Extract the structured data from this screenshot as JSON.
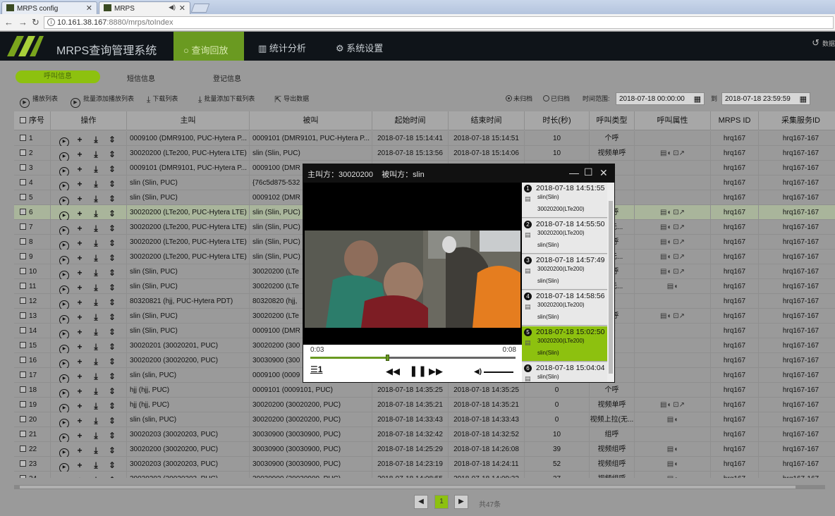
{
  "browser": {
    "tabs": [
      {
        "label": "MRPS config"
      },
      {
        "label": "MRPS"
      }
    ],
    "url_host": "10.161.38.167",
    "url_path": ":8880/mrps/toIndex"
  },
  "header": {
    "brand": "MRPS查询管理系统",
    "menu": [
      {
        "label": "查询回放"
      },
      {
        "label": "统计分析"
      },
      {
        "label": "系统设置"
      }
    ],
    "right_label": "数据"
  },
  "subtabs": [
    {
      "label": "呼叫信息"
    },
    {
      "label": "短信信息"
    },
    {
      "label": "登记信息"
    }
  ],
  "toolbar": {
    "play_list": "播放列表",
    "batch_add_play": "批量添加播放列表",
    "download_list": "下载列表",
    "batch_add_download": "批量添加下载列表",
    "export": "导出数据",
    "radio_unarchived": "未归档",
    "radio_archived": "已归档",
    "time_range": "时间范围:",
    "start_time": "2018-07-18 00:00:00",
    "to": "到",
    "end_time": "2018-07-18 23:59:59"
  },
  "table": {
    "columns": [
      "序号",
      "操作",
      "主叫",
      "被叫",
      "起始时间",
      "结束时间",
      "时长(秒)",
      "呼叫类型",
      "呼叫属性",
      "MRPS ID",
      "采集服务ID"
    ],
    "rows": [
      {
        "no": "1",
        "caller": "0009100 (DMR9100, PUC-Hytera P...",
        "callee": "0009101 (DMR9101, PUC-Hytera P...",
        "start": "2018-07-18 15:14:41",
        "end": "2018-07-18 15:14:51",
        "dur": "10",
        "type": "个呼",
        "attr": "",
        "mrps": "hrq167",
        "svc": "hrq167-167"
      },
      {
        "no": "2",
        "caller": "30020200 (LTe200, PUC-Hytera LTE)",
        "callee": "slin (Slin, PUC)",
        "start": "2018-07-18 15:13:56",
        "end": "2018-07-18 15:14:06",
        "dur": "10",
        "type": "视频单呼",
        "attr": "▤◖ ⊡↗",
        "mrps": "hrq167",
        "svc": "hrq167-167"
      },
      {
        "no": "3",
        "caller": "0009101 (DMR9101, PUC-Hytera P...",
        "callee": "0009100 (DMR",
        "start": "",
        "end": "",
        "dur": "",
        "type": "呼",
        "attr": "",
        "mrps": "hrq167",
        "svc": "hrq167-167"
      },
      {
        "no": "4",
        "caller": "slin (Slin, PUC)",
        "callee": "{76c5d875-532",
        "start": "",
        "end": "",
        "dur": "",
        "type": "级",
        "attr": "",
        "mrps": "hrq167",
        "svc": "hrq167-167"
      },
      {
        "no": "5",
        "caller": "slin (Slin, PUC)",
        "callee": "0009102 (DMR",
        "start": "",
        "end": "",
        "dur": "",
        "type": "呼",
        "attr": "",
        "mrps": "hrq167",
        "svc": "hrq167-167"
      },
      {
        "no": "6",
        "caller": "30020200 (LTe200, PUC-Hytera LTE)",
        "callee": "slin (Slin, PUC)",
        "start": "",
        "end": "",
        "dur": "",
        "type": "单呼",
        "attr": "▤◖ ⊡↗",
        "mrps": "hrq167",
        "svc": "hrq167-167"
      },
      {
        "no": "7",
        "caller": "30020200 (LTe200, PUC-Hytera LTE)",
        "callee": "slin (Slin, PUC)",
        "start": "",
        "end": "",
        "dur": "",
        "type": "呼(无...",
        "attr": "▤◖ ⊡↗",
        "mrps": "hrq167",
        "svc": "hrq167-167"
      },
      {
        "no": "8",
        "caller": "30020200 (LTe200, PUC-Hytera LTE)",
        "callee": "slin (Slin, PUC)",
        "start": "",
        "end": "",
        "dur": "",
        "type": "单呼",
        "attr": "▤◖ ⊡↗",
        "mrps": "hrq167",
        "svc": "hrq167-167"
      },
      {
        "no": "9",
        "caller": "30020200 (LTe200, PUC-Hytera LTE)",
        "callee": "slin (Slin, PUC)",
        "start": "",
        "end": "",
        "dur": "",
        "type": "呼(无...",
        "attr": "▤◖ ⊡↗",
        "mrps": "hrq167",
        "svc": "hrq167-167"
      },
      {
        "no": "10",
        "caller": "slin (Slin, PUC)",
        "callee": "30020200 (LTe",
        "start": "",
        "end": "",
        "dur": "",
        "type": "单呼",
        "attr": "▤◖ ⊡↗",
        "mrps": "hrq167",
        "svc": "hrq167-167"
      },
      {
        "no": "11",
        "caller": "slin (Slin, PUC)",
        "callee": "30020200 (LTe",
        "start": "",
        "end": "",
        "dur": "",
        "type": "拉(无...",
        "attr": "▤◖",
        "mrps": "hrq167",
        "svc": "hrq167-167"
      },
      {
        "no": "12",
        "caller": "80320821 (hjj, PUC-Hytera PDT)",
        "callee": "80320820 (hjj,",
        "start": "",
        "end": "",
        "dur": "",
        "type": "呼",
        "attr": "",
        "mrps": "hrq167",
        "svc": "hrq167-167"
      },
      {
        "no": "13",
        "caller": "slin (Slin, PUC)",
        "callee": "30020200 (LTe",
        "start": "",
        "end": "",
        "dur": "",
        "type": "单呼",
        "attr": "▤◖ ⊡↗",
        "mrps": "hrq167",
        "svc": "hrq167-167"
      },
      {
        "no": "14",
        "caller": "slin (Slin, PUC)",
        "callee": "0009100 (DMR",
        "start": "",
        "end": "",
        "dur": "",
        "type": "呼",
        "attr": "",
        "mrps": "hrq167",
        "svc": "hrq167-167"
      },
      {
        "no": "15",
        "caller": "30020201 (30020201, PUC)",
        "callee": "30020200 (300",
        "start": "",
        "end": "",
        "dur": "",
        "type": "呼",
        "attr": "",
        "mrps": "hrq167",
        "svc": "hrq167-167"
      },
      {
        "no": "16",
        "caller": "30020200 (30020200, PUC)",
        "callee": "30030900 (300",
        "start": "",
        "end": "",
        "dur": "",
        "type": "呼",
        "attr": "",
        "mrps": "hrq167",
        "svc": "hrq167-167"
      },
      {
        "no": "17",
        "caller": "slin (slin, PUC)",
        "callee": "0009100 (0009",
        "start": "",
        "end": "",
        "dur": "",
        "type": "呼",
        "attr": "",
        "mrps": "hrq167",
        "svc": "hrq167-167"
      },
      {
        "no": "18",
        "caller": "hjj (hjj, PUC)",
        "callee": "0009101 (0009101, PUC)",
        "start": "2018-07-18 14:35:25",
        "end": "2018-07-18 14:35:25",
        "dur": "0",
        "type": "个呼",
        "attr": "",
        "mrps": "hrq167",
        "svc": "hrq167-167"
      },
      {
        "no": "19",
        "caller": "hjj (hjj, PUC)",
        "callee": "30020200 (30020200, PUC)",
        "start": "2018-07-18 14:35:21",
        "end": "2018-07-18 14:35:21",
        "dur": "0",
        "type": "视频单呼",
        "attr": "▤◖ ⊡↗",
        "mrps": "hrq167",
        "svc": "hrq167-167"
      },
      {
        "no": "20",
        "caller": "slin (slin, PUC)",
        "callee": "30020200 (30020200, PUC)",
        "start": "2018-07-18 14:33:43",
        "end": "2018-07-18 14:33:43",
        "dur": "0",
        "type": "视频上拉(无...",
        "attr": "▤◖",
        "mrps": "hrq167",
        "svc": "hrq167-167"
      },
      {
        "no": "21",
        "caller": "30020203 (30020203, PUC)",
        "callee": "30030900 (30030900, PUC)",
        "start": "2018-07-18 14:32:42",
        "end": "2018-07-18 14:32:52",
        "dur": "10",
        "type": "组呼",
        "attr": "",
        "mrps": "hrq167",
        "svc": "hrq167-167"
      },
      {
        "no": "22",
        "caller": "30020200 (30020200, PUC)",
        "callee": "30030900 (30030900, PUC)",
        "start": "2018-07-18 14:25:29",
        "end": "2018-07-18 14:26:08",
        "dur": "39",
        "type": "视频组呼",
        "attr": "▤◖",
        "mrps": "hrq167",
        "svc": "hrq167-167"
      },
      {
        "no": "23",
        "caller": "30020203 (30020203, PUC)",
        "callee": "30030900 (30030900, PUC)",
        "start": "2018-07-18 14:23:19",
        "end": "2018-07-18 14:24:11",
        "dur": "52",
        "type": "视频组呼",
        "attr": "▤◖",
        "mrps": "hrq167",
        "svc": "hrq167-167"
      },
      {
        "no": "24",
        "caller": "30020203 (30020203, PUC)",
        "callee": "30030900 (30030900, PUC)",
        "start": "2018-07-18 14:08:55",
        "end": "2018-07-18 14:09:32",
        "dur": "37",
        "type": "视频组呼",
        "attr": "▤◖",
        "mrps": "hrq167",
        "svc": "hrq167-167"
      }
    ]
  },
  "pager": {
    "prev": "◀",
    "current": "1",
    "next": "▶",
    "total": "共47条"
  },
  "player": {
    "title_caller": "主叫方：30020200",
    "title_callee": "被叫方：slin",
    "time_current": "0:03",
    "time_total": "0:08",
    "progress": 0.375,
    "playlist": [
      {
        "num": "1",
        "time": "2018-07-18 14:51:55",
        "from": "slin(Slin)",
        "to": "30020200(LTe200)"
      },
      {
        "num": "2",
        "time": "2018-07-18 14:55:50",
        "from": "30020200(LTe200)",
        "to": "slin(Slin)"
      },
      {
        "num": "3",
        "time": "2018-07-18 14:57:49",
        "from": "30020200(LTe200)",
        "to": "slin(Slin)"
      },
      {
        "num": "4",
        "time": "2018-07-18 14:58:56",
        "from": "30020200(LTe200)",
        "to": "slin(Slin)"
      },
      {
        "num": "5",
        "time": "2018-07-18 15:02:50",
        "from": "30020200(LTe200)",
        "to": "slin(Slin)"
      },
      {
        "num": "6",
        "time": "2018-07-18 15:04:04",
        "from": "slin(Slin)",
        "to": ""
      }
    ],
    "selected_index": 4
  },
  "colors": {
    "accent": "#8dc10f",
    "header_bg": "#0f1419",
    "active_menu": "#6a9a21"
  }
}
